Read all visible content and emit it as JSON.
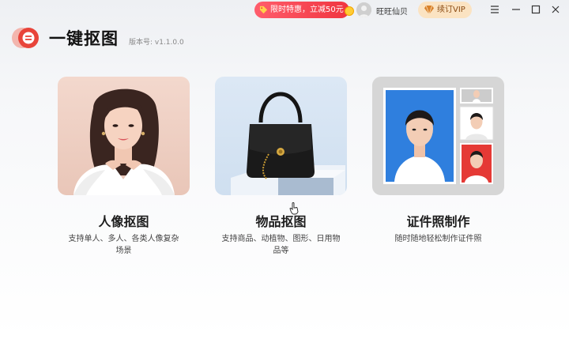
{
  "topbar": {
    "promo_label": "限时特惠，立减50元",
    "username": "旺旺仙贝",
    "vip_label": "续订VIP"
  },
  "brand": {
    "app_name": "一键抠图",
    "version": "版本号: v1.1.0.0"
  },
  "cards": [
    {
      "title": "人像抠图",
      "desc": "支持单人、多人、各类人像复杂场景"
    },
    {
      "title": "物品抠图",
      "desc": "支持商品、动植物、图形、日用物品等"
    },
    {
      "title": "证件照制作",
      "desc": "随时随地轻松制作证件照"
    }
  ],
  "colors": {
    "promo": "#f0353f",
    "vip_bg": "#fbe3c2",
    "logo": "#e8443a",
    "id_blue": "#2f7fde",
    "id_red": "#e53935"
  }
}
